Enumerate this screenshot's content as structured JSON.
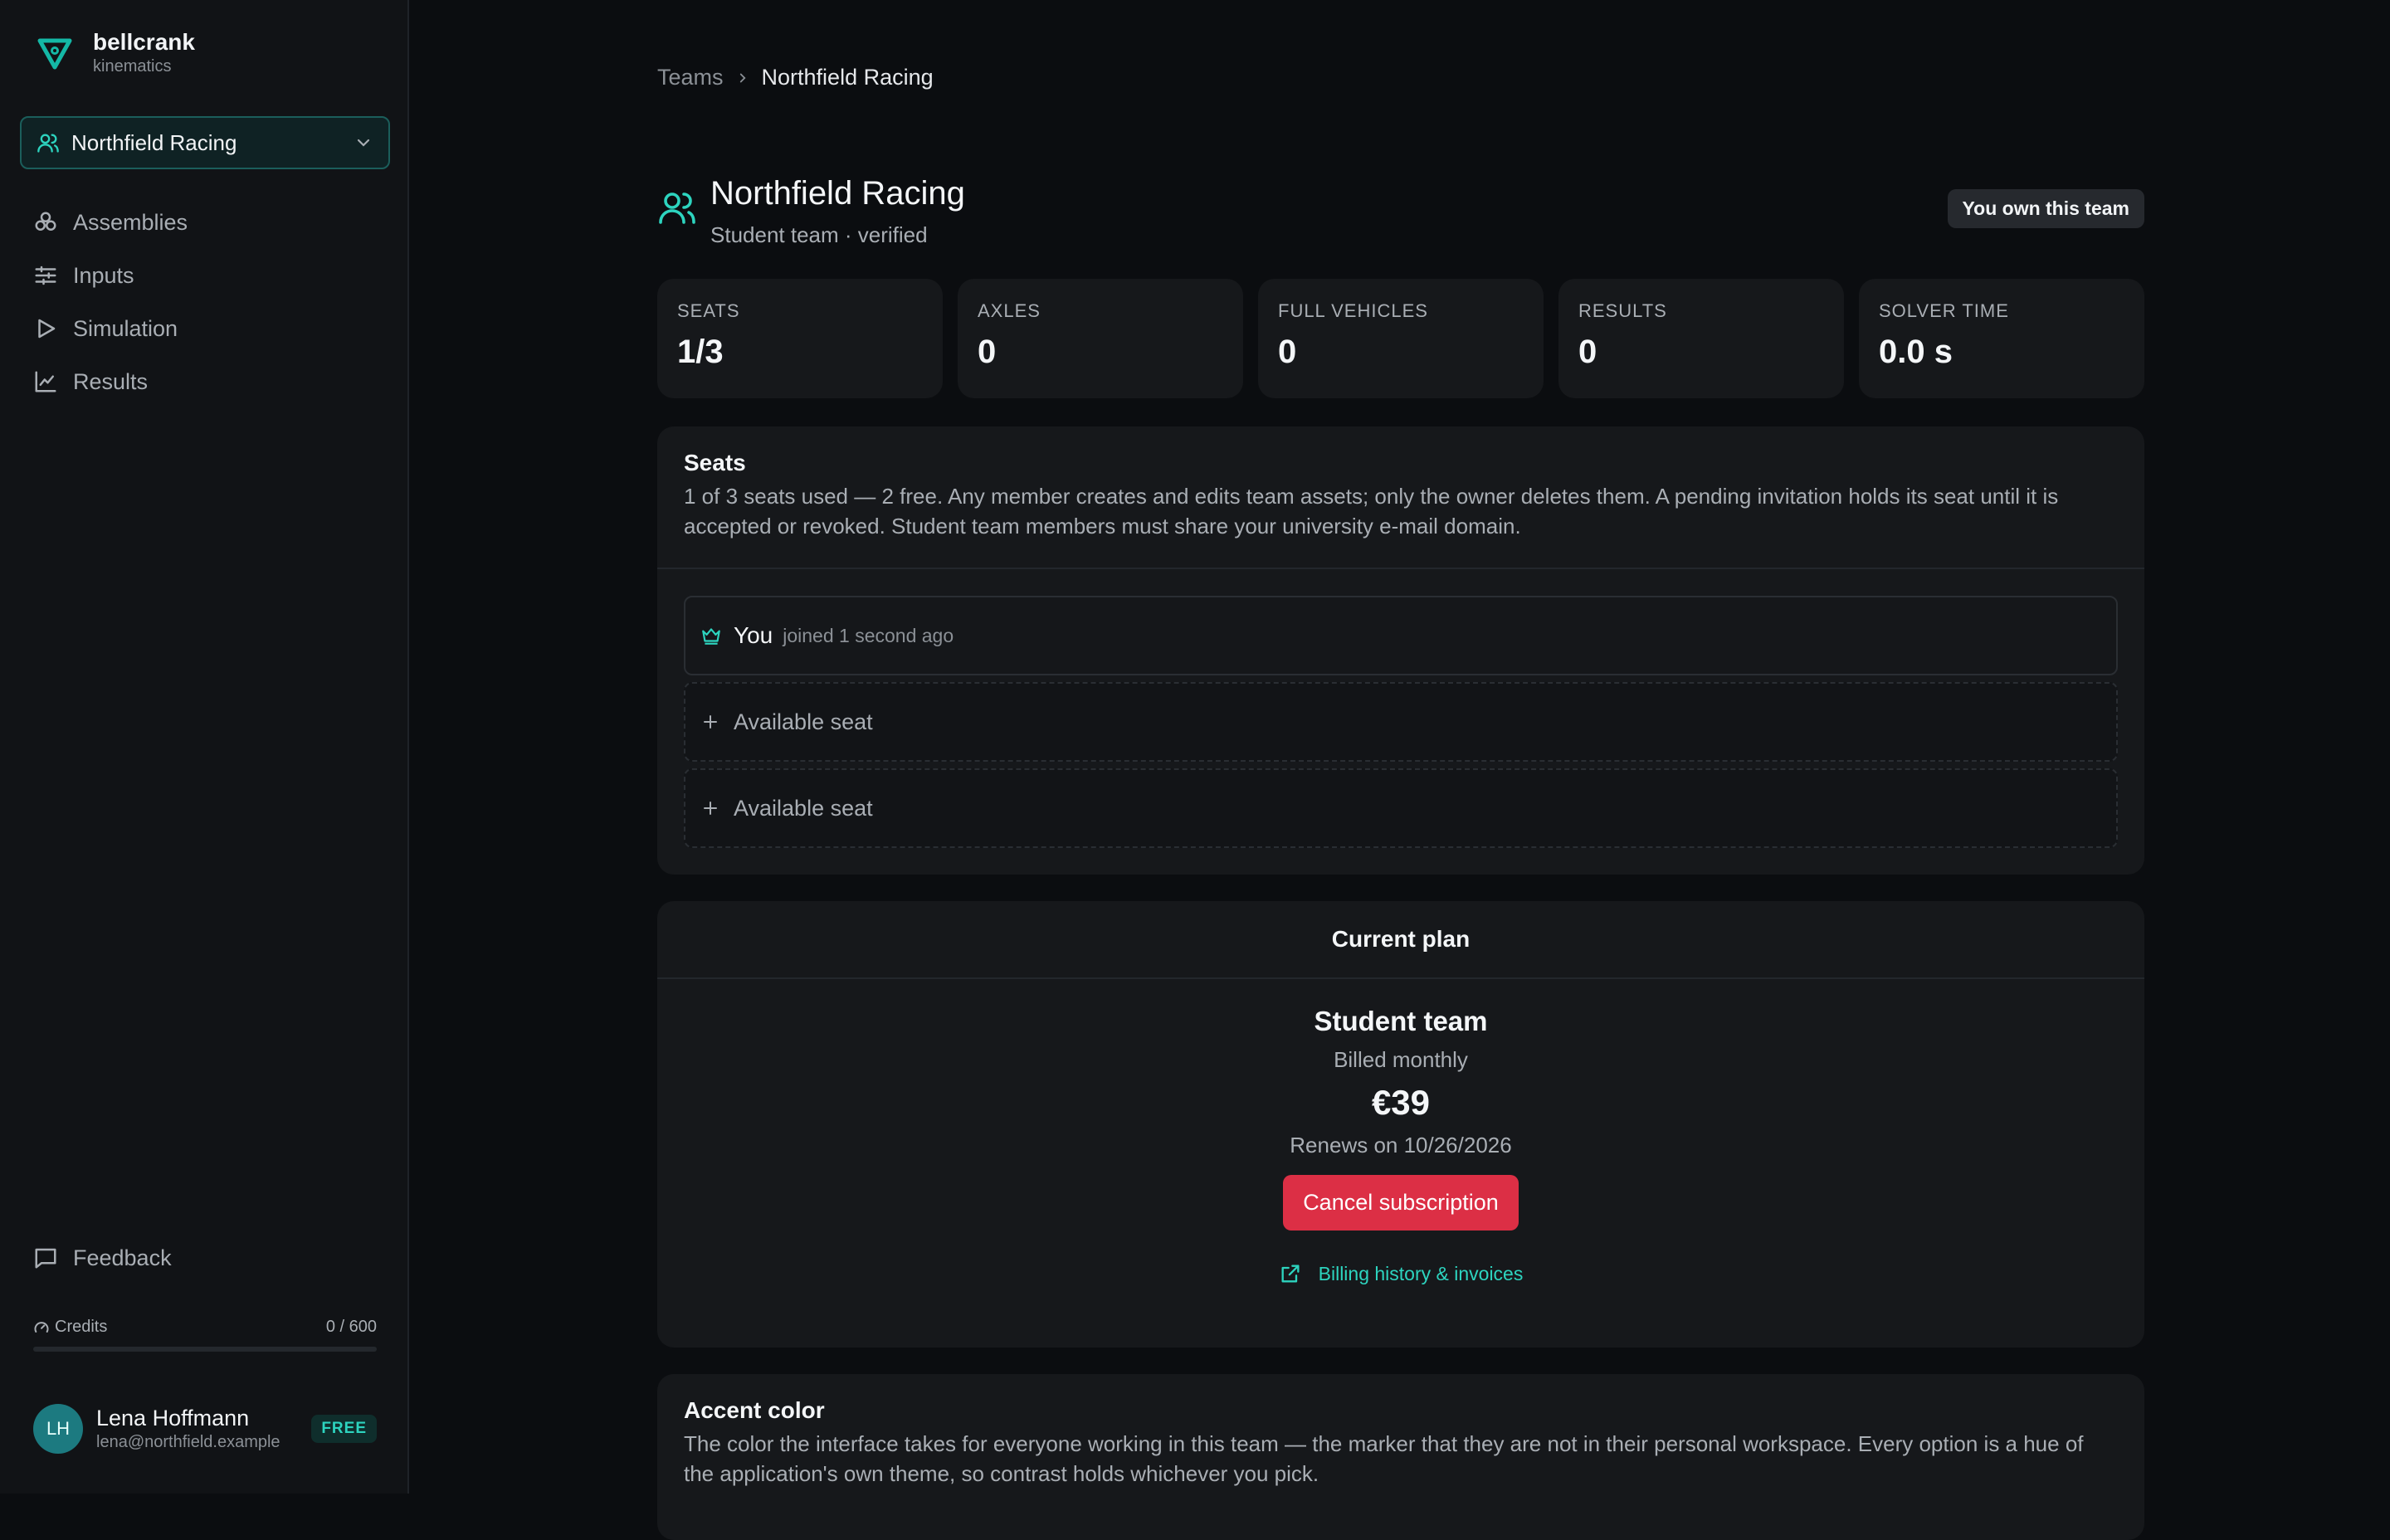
{
  "brand": {
    "name": "bellcrank",
    "subtitle": "kinematics"
  },
  "team_selector": {
    "value": "Northfield Racing"
  },
  "nav": [
    {
      "label": "Assemblies",
      "icon": "assemblies-icon"
    },
    {
      "label": "Inputs",
      "icon": "sliders-icon"
    },
    {
      "label": "Simulation",
      "icon": "play-icon"
    },
    {
      "label": "Results",
      "icon": "chart-line-icon"
    }
  ],
  "feedback": {
    "label": "Feedback"
  },
  "credits": {
    "label": "Credits",
    "value": "0 / 600",
    "used_fraction": 0
  },
  "user": {
    "initials": "LH",
    "name": "Lena Hoffmann",
    "email": "lena@northfield.example",
    "plan": "FREE"
  },
  "breadcrumb": {
    "root": "Teams",
    "current": "Northfield Racing"
  },
  "team": {
    "name": "Northfield Racing",
    "subtitle": "Student team · verified",
    "owner_badge": "You own this team"
  },
  "stats": [
    {
      "label": "SEATS",
      "value": "1/3"
    },
    {
      "label": "AXLES",
      "value": "0"
    },
    {
      "label": "FULL VEHICLES",
      "value": "0"
    },
    {
      "label": "RESULTS",
      "value": "0"
    },
    {
      "label": "SOLVER TIME",
      "value": "0.0 s"
    }
  ],
  "seats": {
    "title": "Seats",
    "description": "1 of 3 seats used — 2 free. Any member creates and edits team assets; only the owner deletes them. A pending invitation holds its seat until it is accepted or revoked. Student team members must share your university e-mail domain.",
    "owner": {
      "name": "You",
      "joined": "joined 1 second ago"
    },
    "free_label": "Available seat"
  },
  "plan": {
    "header": "Current plan",
    "name": "Student team",
    "billing": "Billed monthly",
    "price": "€39",
    "renews": "Renews on 10/26/2026",
    "cancel_label": "Cancel subscription",
    "billing_link": "Billing history & invoices"
  },
  "accent": {
    "title": "Accent color",
    "description": "The color the interface takes for everyone working in this team — the marker that they are not in their personal workspace. Every option is a hue of the application's own theme, so contrast holds whichever you pick."
  },
  "colors": {
    "accent": "#14b8a6",
    "danger": "#dc2f45",
    "background": "#0b0d10"
  }
}
